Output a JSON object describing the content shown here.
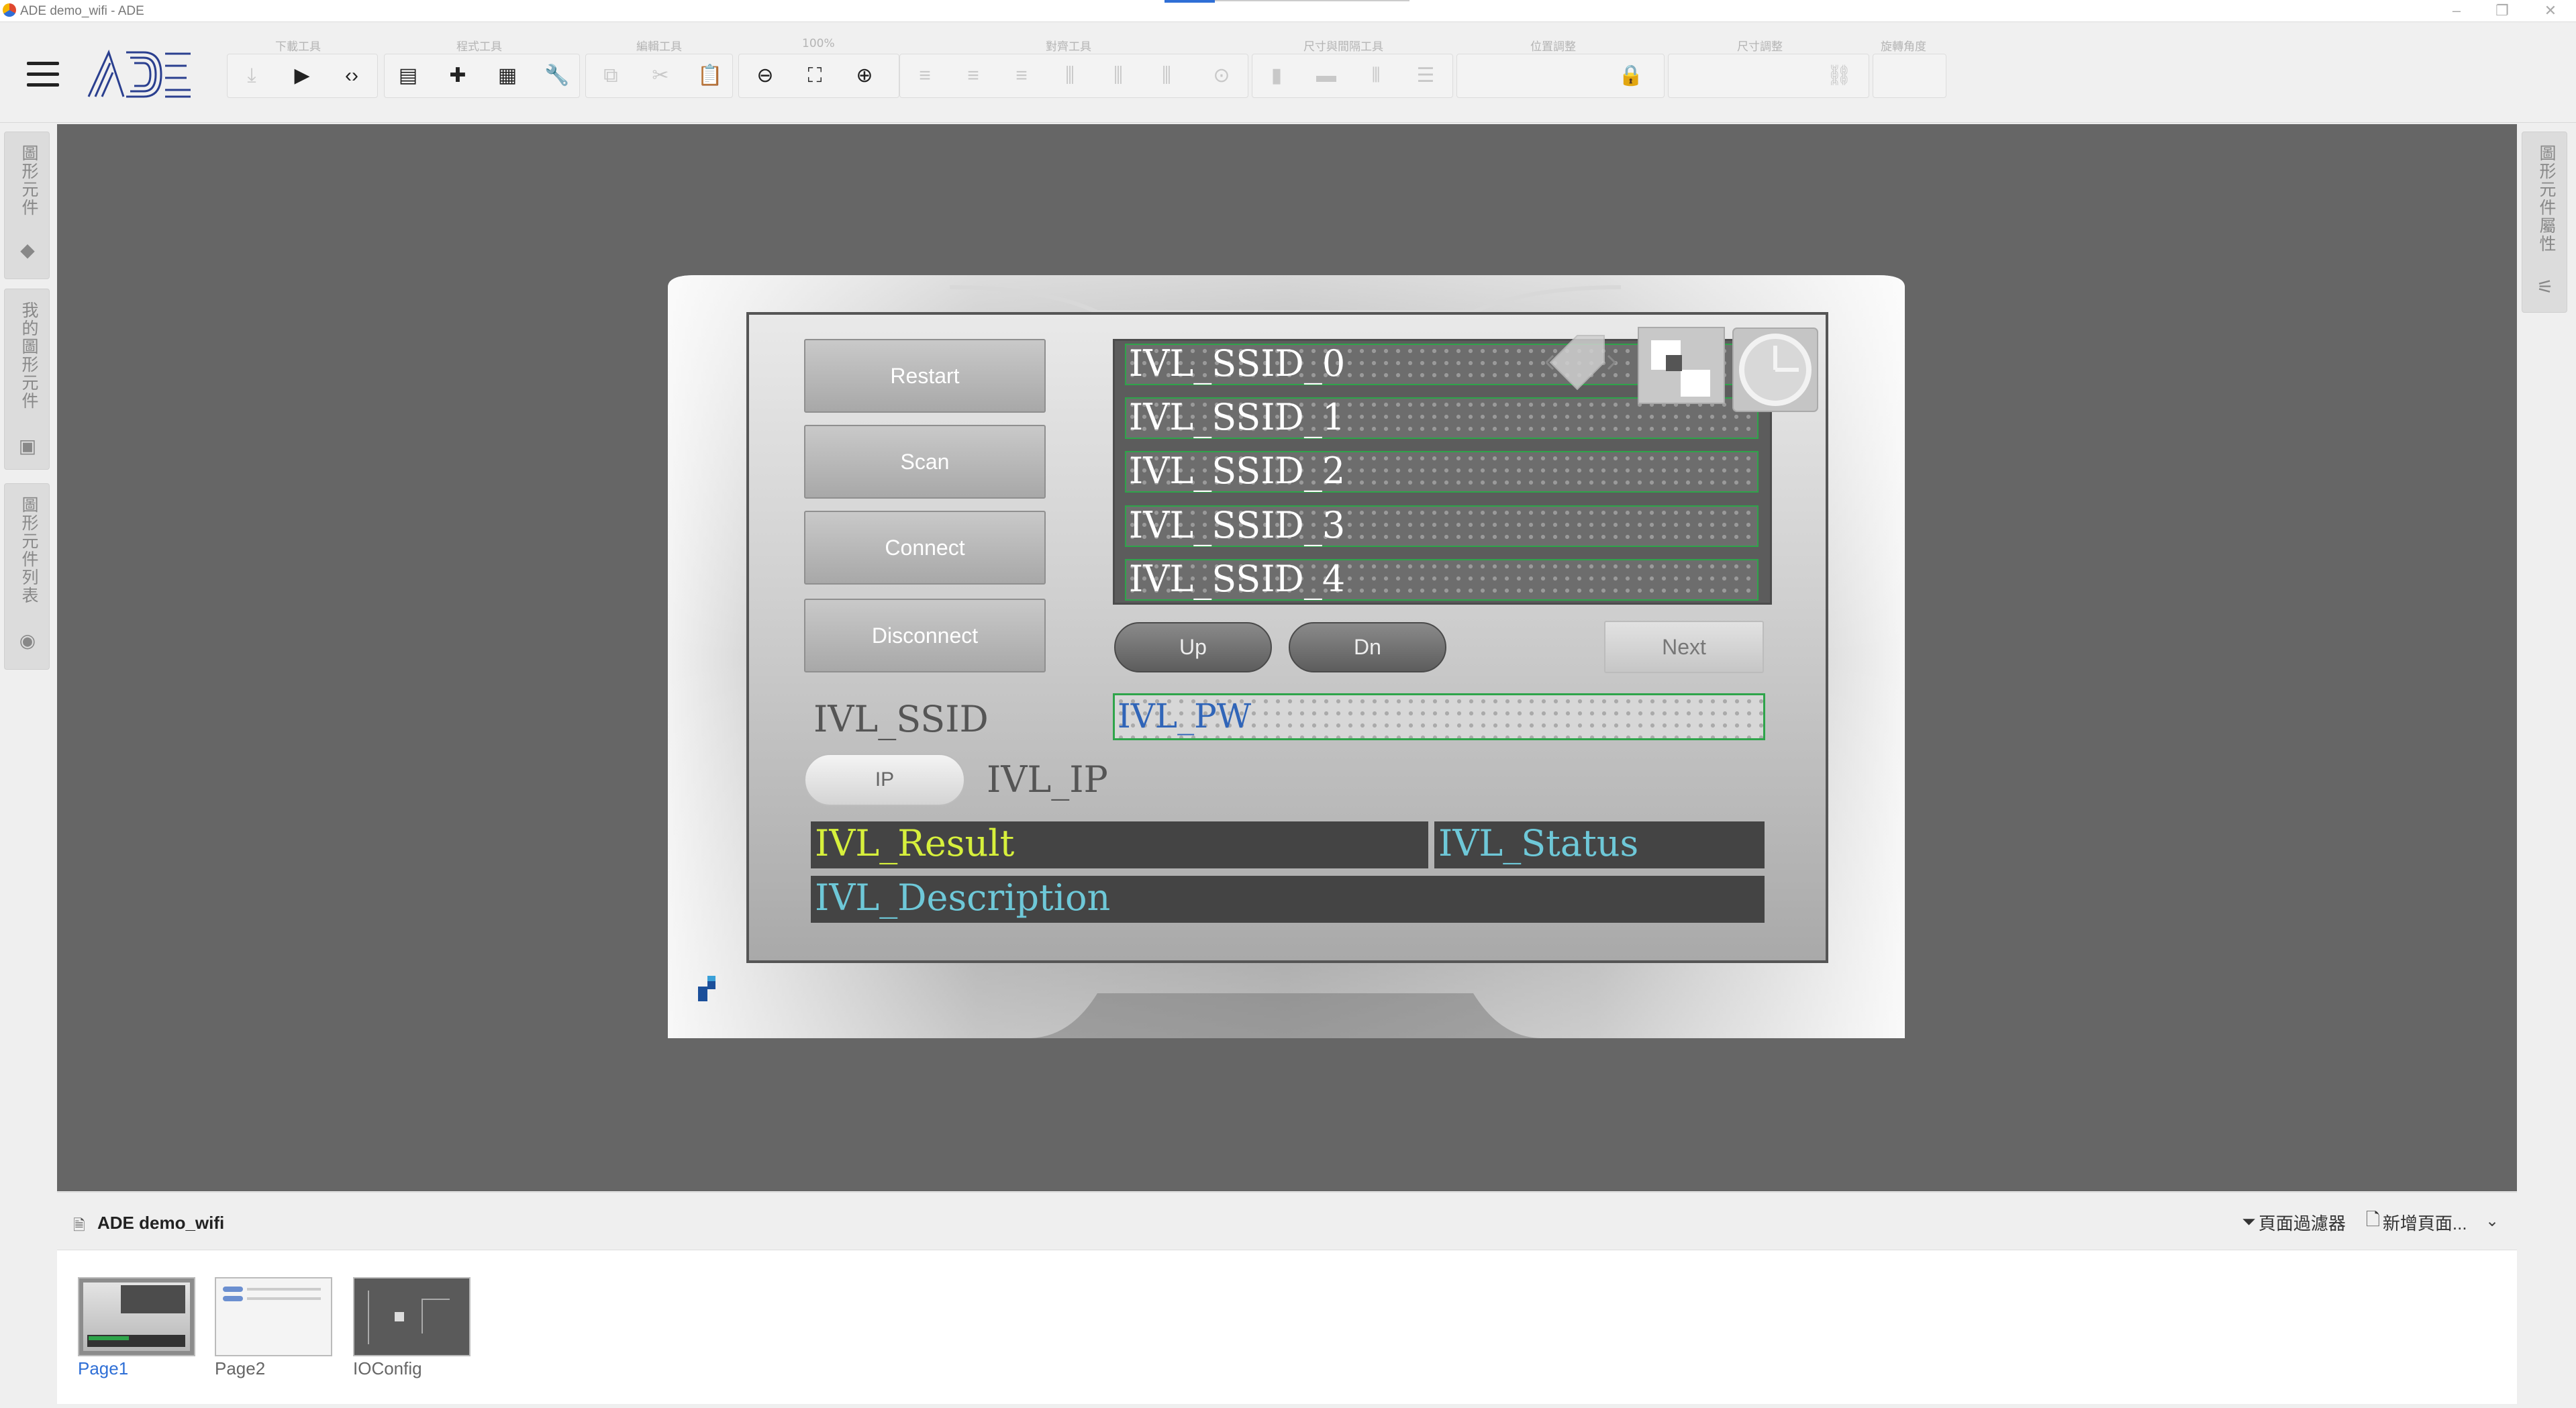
{
  "window": {
    "title": "ADE demo_wifi - ADE"
  },
  "toolbar": {
    "groups": [
      {
        "label": "下載工具"
      },
      {
        "label": "程式工具"
      },
      {
        "label": "編輯工具"
      },
      {
        "label": "100%"
      },
      {
        "label": "對齊工具"
      },
      {
        "label": "尺寸與間隔工具"
      },
      {
        "label": "位置調整"
      },
      {
        "label": "尺寸調整"
      },
      {
        "label": "旋轉角度"
      }
    ]
  },
  "left_tabs": [
    {
      "label": "圖形元件"
    },
    {
      "label": "我的圖形元件"
    },
    {
      "label": "圖形元件列表"
    }
  ],
  "right_tab": {
    "label": "圖形元件屬性"
  },
  "hmi": {
    "buttons": {
      "restart": "Restart",
      "scan": "Scan",
      "connect": "Connect",
      "disconnect": "Disconnect",
      "up": "Up",
      "dn": "Dn",
      "next": "Next",
      "ip": "IP"
    },
    "ssid_list": [
      "IVL_SSID_0",
      "IVL_SSID_1",
      "IVL_SSID_2",
      "IVL_SSID_3",
      "IVL_SSID_4"
    ],
    "ssid_label": "IVL_SSID",
    "pw_field": "IVL_PW",
    "ip_label": "IVL_IP",
    "result": "IVL_Result",
    "status": "IVL_Status",
    "description": "IVL_Description",
    "colors": {
      "result": "#d7f03c",
      "status": "#6ec8d8",
      "description": "#6ec8d8"
    }
  },
  "pages_panel": {
    "title": "ADE demo_wifi",
    "filter_label": "頁面過濾器",
    "add_page_label": "新增頁面...",
    "pages": [
      {
        "name": "Page1",
        "selected": true
      },
      {
        "name": "Page2",
        "selected": false
      },
      {
        "name": "IOConfig",
        "selected": false
      }
    ]
  }
}
